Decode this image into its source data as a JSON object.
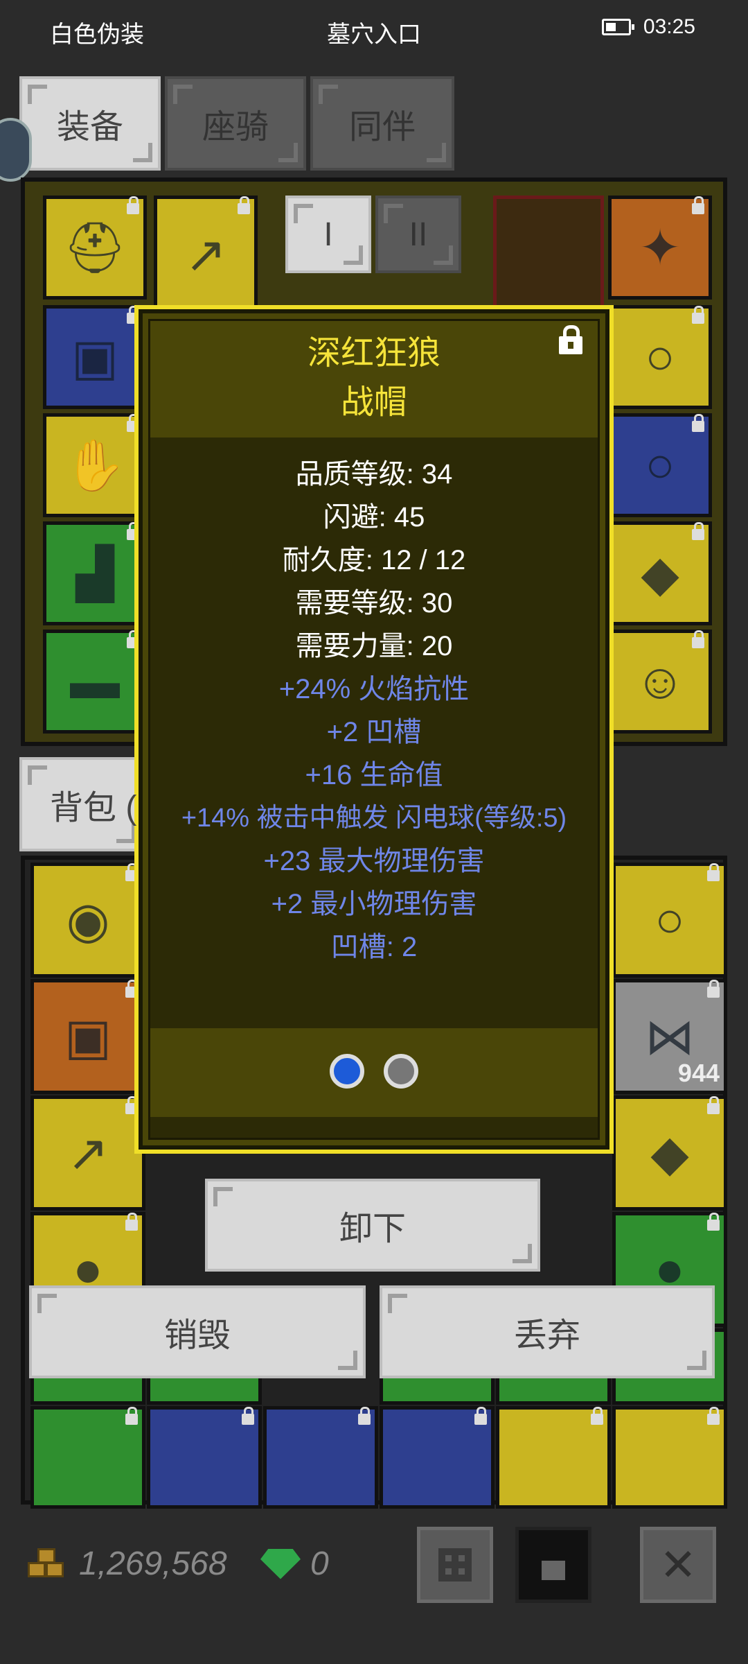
{
  "status_bar": {
    "left": "白色伪装",
    "center": "墓穴入口",
    "time": "03:25"
  },
  "tabs": [
    {
      "label": "装备",
      "active": true
    },
    {
      "label": "座骑",
      "active": false
    },
    {
      "label": "同伴",
      "active": false
    }
  ],
  "set_buttons": [
    "I",
    "II"
  ],
  "inventory_tab_label": "背包 (",
  "tooltip": {
    "title": "深红狂狼",
    "subtitle": "战帽",
    "stats": [
      "品质等级: 34",
      "闪避: 45",
      "耐久度: 12 / 12",
      "需要等级: 30",
      "需要力量: 20"
    ],
    "bonuses": [
      "+24% 火焰抗性",
      "+2 凹槽",
      "+16 生命值",
      "+14% 被击中触发 闪电球(等级:5)",
      "+23 最大物理伤害",
      "+2 最小物理伤害",
      "凹槽: 2"
    ],
    "socketed_gems": [
      "blue-gem-icon",
      "gray-gem-icon"
    ]
  },
  "actions": {
    "unequip": "卸下",
    "destroy": "销毁",
    "drop": "丢弃"
  },
  "item_stack_count": "944",
  "currency": {
    "gold": "1,269,568",
    "gems": "0"
  },
  "colors": {
    "tooltip_title": "#f6e43a",
    "stat_white": "#ffffff",
    "bonus_blue": "#6f86e8",
    "slot_yellow": "#c9b521",
    "slot_blue": "#2e3f8f",
    "slot_green": "#2f8f2f"
  }
}
